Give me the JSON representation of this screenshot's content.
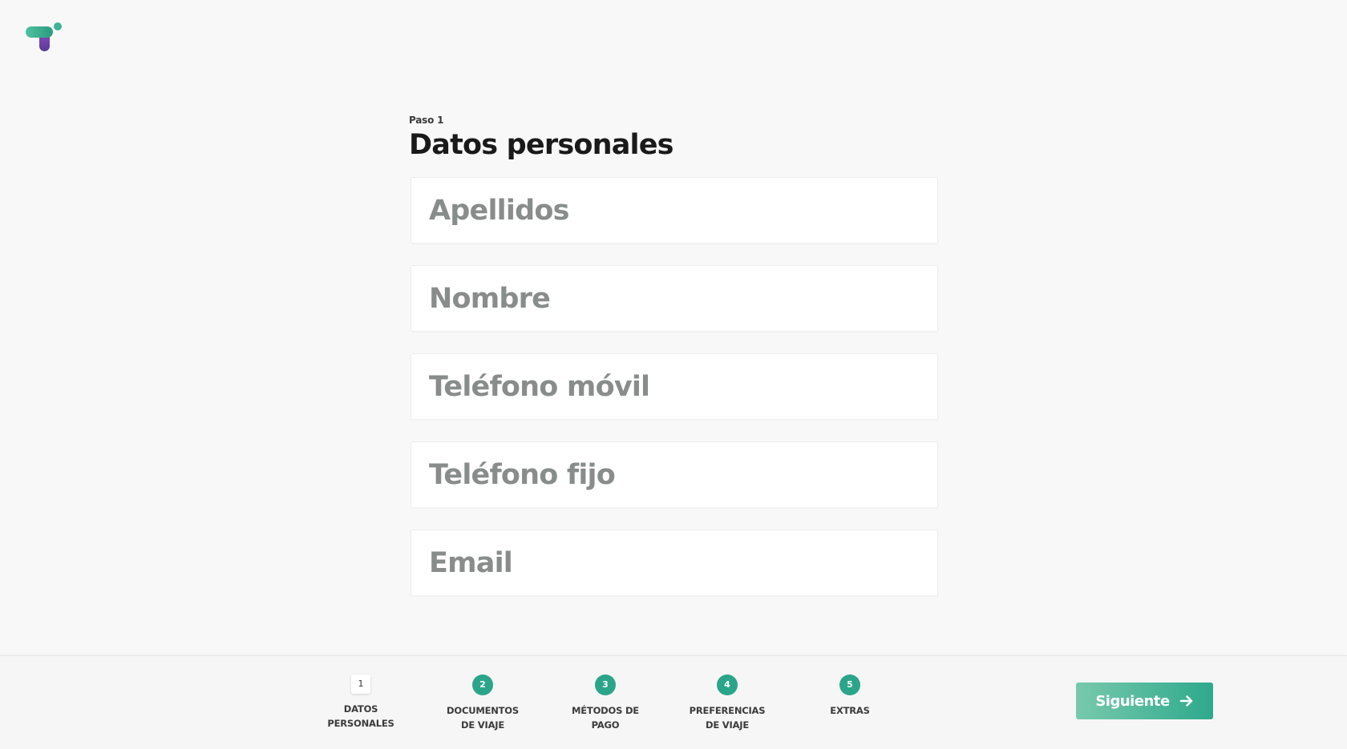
{
  "header": {
    "logo_icon": "brand-logo"
  },
  "form": {
    "step_kicker": "Paso 1",
    "title": "Datos personales",
    "fields": [
      {
        "name": "apellidos",
        "placeholder": "Apellidos"
      },
      {
        "name": "nombre",
        "placeholder": "Nombre"
      },
      {
        "name": "telefono-movil",
        "placeholder": "Teléfono móvil"
      },
      {
        "name": "telefono-fijo",
        "placeholder": "Teléfono fijo"
      },
      {
        "name": "email",
        "placeholder": "Email"
      }
    ]
  },
  "stepper": {
    "steps": [
      {
        "number": "1",
        "line1": "DATOS",
        "line2": "PERSONALES",
        "current": true
      },
      {
        "number": "2",
        "line1": "DOCUMENTOS",
        "line2": "DE VIAJE",
        "current": false
      },
      {
        "number": "3",
        "line1": "MÉTODOS DE",
        "line2": "PAGO",
        "current": false
      },
      {
        "number": "4",
        "line1": "PREFERENCIAS",
        "line2": "DE VIAJE",
        "current": false
      },
      {
        "number": "5",
        "line1": "EXTRAS",
        "line2": "",
        "current": false
      }
    ]
  },
  "footer": {
    "next_label": "Siguiente",
    "next_icon": "arrow-right-icon"
  },
  "colors": {
    "accent": "#2aa58a",
    "background": "#f8f8f8",
    "placeholder": "#888d8c"
  }
}
